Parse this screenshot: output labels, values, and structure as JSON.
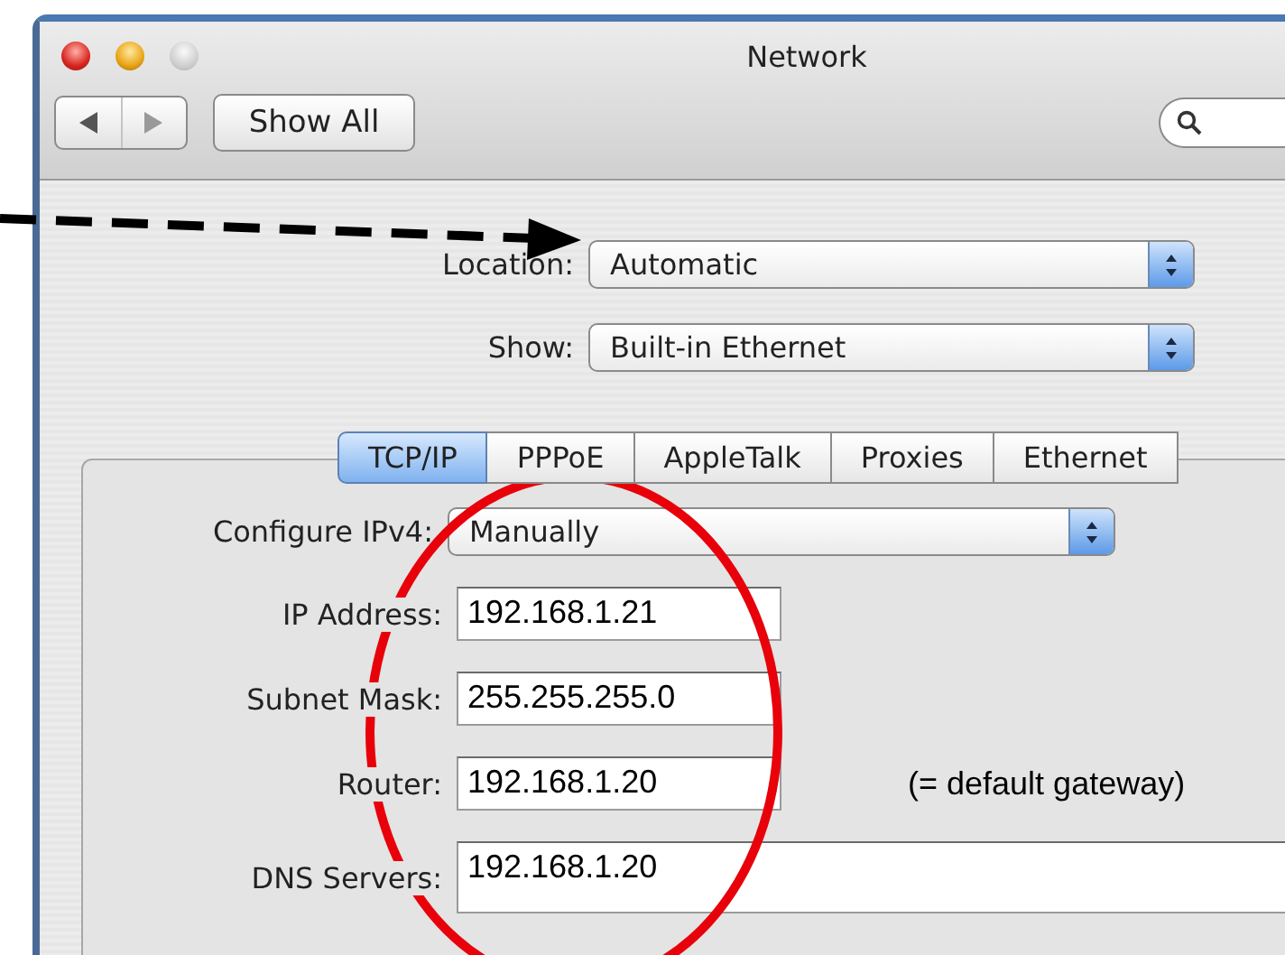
{
  "window": {
    "title": "Network"
  },
  "toolbar": {
    "show_all": "Show All"
  },
  "location": {
    "label": "Location:",
    "value": "Automatic"
  },
  "show": {
    "label": "Show:",
    "value": "Built-in Ethernet"
  },
  "tabs": [
    {
      "label": "TCP/IP",
      "selected": true
    },
    {
      "label": "PPPoE",
      "selected": false
    },
    {
      "label": "AppleTalk",
      "selected": false
    },
    {
      "label": "Proxies",
      "selected": false
    },
    {
      "label": "Ethernet",
      "selected": false
    }
  ],
  "configure": {
    "label": "Configure IPv4:",
    "value": "Manually"
  },
  "fields": [
    {
      "kind": "line",
      "label": "IP Address:",
      "value": "192.168.1.21"
    },
    {
      "kind": "line",
      "label": "Subnet Mask:",
      "value": "255.255.255.0"
    },
    {
      "kind": "line",
      "label": "Router:",
      "value": "192.168.1.20",
      "note": "(= default gateway)"
    },
    {
      "kind": "area",
      "label": "DNS Servers:",
      "value": "192.168.1.20"
    }
  ]
}
